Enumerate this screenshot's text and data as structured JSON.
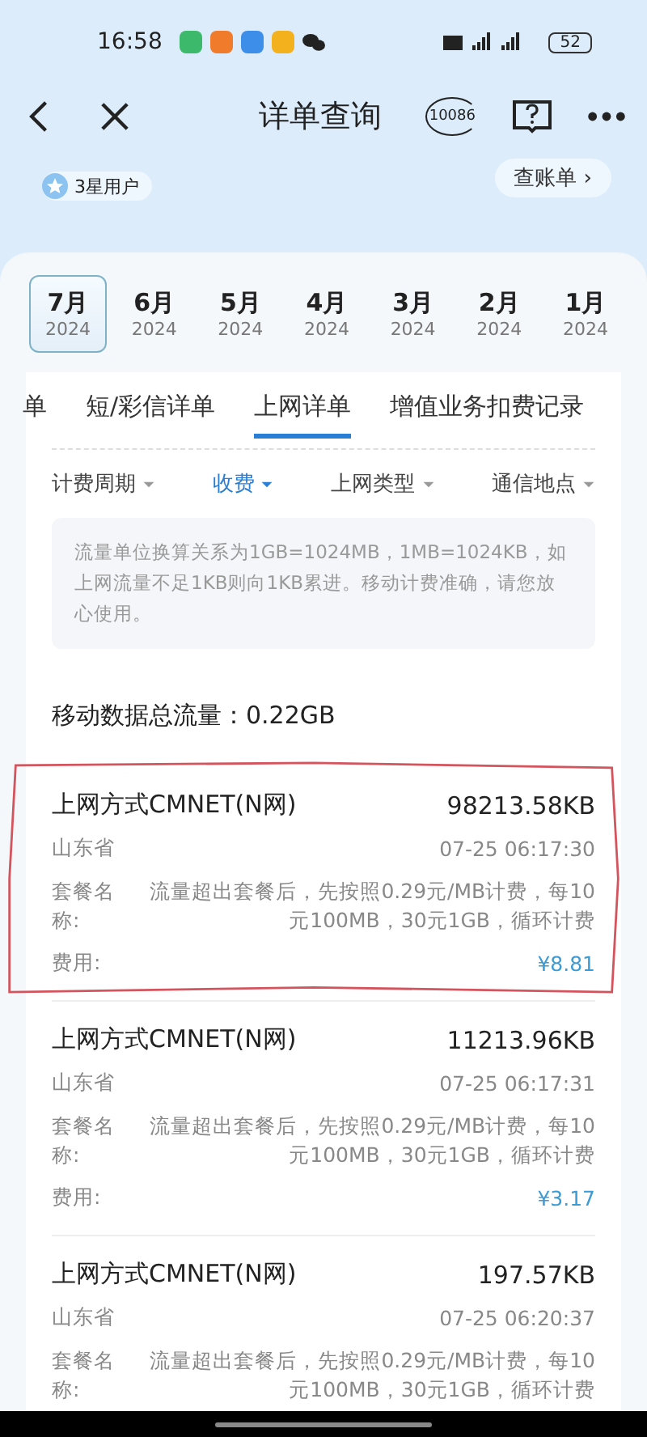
{
  "status_bar": {
    "time": "16:58",
    "battery": "52"
  },
  "header": {
    "title": "详单查询",
    "hotline": "10086"
  },
  "account": {
    "badge": "3星用户",
    "bill_button": "查账单 ›"
  },
  "months": [
    {
      "month": "7月",
      "year": "2024",
      "selected": true
    },
    {
      "month": "6月",
      "year": "2024",
      "selected": false
    },
    {
      "month": "5月",
      "year": "2024",
      "selected": false
    },
    {
      "month": "4月",
      "year": "2024",
      "selected": false
    },
    {
      "month": "3月",
      "year": "2024",
      "selected": false
    },
    {
      "month": "2月",
      "year": "2024",
      "selected": false
    },
    {
      "month": "1月",
      "year": "2024",
      "selected": false
    }
  ],
  "tabs": [
    {
      "label": "单",
      "selected": false
    },
    {
      "label": "短/彩信详单",
      "selected": false
    },
    {
      "label": "上网详单",
      "selected": true
    },
    {
      "label": "增值业务扣费记录",
      "selected": false
    }
  ],
  "filters": [
    {
      "label": "计费周期",
      "selected": false
    },
    {
      "label": "收费",
      "selected": true
    },
    {
      "label": "上网类型",
      "selected": false
    },
    {
      "label": "通信地点",
      "selected": false
    }
  ],
  "notice": "流量单位换算关系为1GB=1024MB，1MB=1024KB，如上网流量不足1KB则向1KB累进。移动计费准确，请您放心使用。",
  "total": "移动数据总流量：0.22GB",
  "records": [
    {
      "type": "上网方式CMNET(N网)",
      "amount": "98213.58KB",
      "place": "山东省",
      "time": "07-25 06:17:30",
      "package_label": "套餐名称:",
      "package": "流量超出套餐后，先按照0.29元/MB计费，每10元100MB，30元1GB，循环计费",
      "fee_label": "费用:",
      "fee": "¥8.81",
      "annotated": true
    },
    {
      "type": "上网方式CMNET(N网)",
      "amount": "11213.96KB",
      "place": "山东省",
      "time": "07-25 06:17:31",
      "package_label": "套餐名称:",
      "package": "流量超出套餐后，先按照0.29元/MB计费，每10元100MB，30元1GB，循环计费",
      "fee_label": "费用:",
      "fee": "¥3.17",
      "annotated": false
    },
    {
      "type": "上网方式CMNET(N网)",
      "amount": "197.57KB",
      "place": "山东省",
      "time": "07-25 06:20:37",
      "package_label": "套餐名称:",
      "package": "流量超出套餐后，先按照0.29元/MB计费，每10元100MB，30元1GB，循环计费",
      "annotated": false
    }
  ]
}
